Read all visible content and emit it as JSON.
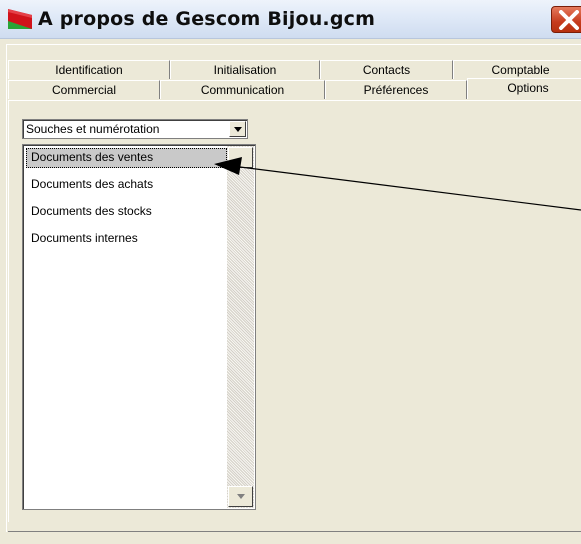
{
  "window": {
    "title": "A propos de Gescom Bijou.gcm",
    "app_icon": "red-green-app-icon",
    "close_icon": "close-x-icon",
    "colors": {
      "titlebar": "#dfe9f7",
      "close_button": "#c63b1d",
      "face": "#ece9d8"
    }
  },
  "tabs": {
    "row1": [
      "Identification",
      "Initialisation",
      "Contacts",
      "Comptable"
    ],
    "row2": [
      "Commercial",
      "Communication",
      "Préférences",
      "Options"
    ],
    "selected": "Options"
  },
  "options": {
    "dropdown": {
      "value": "Souches et numérotation",
      "icon": "dropdown-arrow-icon"
    },
    "list": {
      "items": [
        "Documents des ventes",
        "Documents des achats",
        "Documents des stocks",
        "Documents internes"
      ],
      "selected": "Documents des ventes",
      "selection_color": "#c9c9c9"
    }
  }
}
